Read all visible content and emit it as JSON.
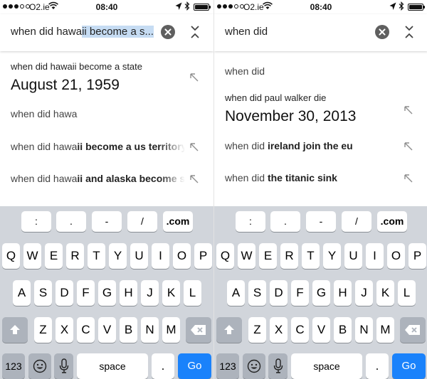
{
  "left": {
    "status": {
      "carrier": "O2.ie",
      "time": "08:40"
    },
    "search": {
      "query_plain": "when did hawa",
      "query_selected": "ii become a s..."
    },
    "answer": {
      "question": "when did hawaii become a state",
      "value": "August 21, 1959"
    },
    "suggestions": [
      {
        "prefix": "when did hawa",
        "bold": ""
      },
      {
        "prefix": "when did hawa",
        "bold": "ii become a us territory"
      },
      {
        "prefix": "when did hawa",
        "bold": "ii and alaska become states"
      }
    ]
  },
  "right": {
    "status": {
      "carrier": "O2.ie",
      "time": "08:40"
    },
    "search": {
      "query": "when did"
    },
    "top_suggestion": {
      "prefix": "when did",
      "bold": ""
    },
    "answer": {
      "question": "when did paul walker die",
      "value": "November 30, 2013"
    },
    "suggestions": [
      {
        "prefix": "when did ",
        "bold": "ireland join the eu"
      },
      {
        "prefix": "when did ",
        "bold": "the titanic sink"
      }
    ]
  },
  "keyboard": {
    "extra_keys": [
      ":",
      ".",
      "-",
      "/",
      ".com"
    ],
    "row1": [
      "Q",
      "W",
      "E",
      "R",
      "T",
      "Y",
      "U",
      "I",
      "O",
      "P"
    ],
    "row2": [
      "A",
      "S",
      "D",
      "F",
      "G",
      "H",
      "J",
      "K",
      "L"
    ],
    "row3": [
      "Z",
      "X",
      "C",
      "V",
      "B",
      "N",
      "M"
    ],
    "numbers_label": "123",
    "space_label": "space",
    "period_label": ".",
    "go_label": "Go",
    "icons": {
      "shift": "shift-arrow-icon",
      "delete": "backspace-icon",
      "emoji": "smiley-icon",
      "mic": "microphone-icon"
    }
  },
  "colors": {
    "go_key": "#1a82fb",
    "highlight": "#c6dcf3",
    "keyboard_bg": "#d1d5db"
  }
}
